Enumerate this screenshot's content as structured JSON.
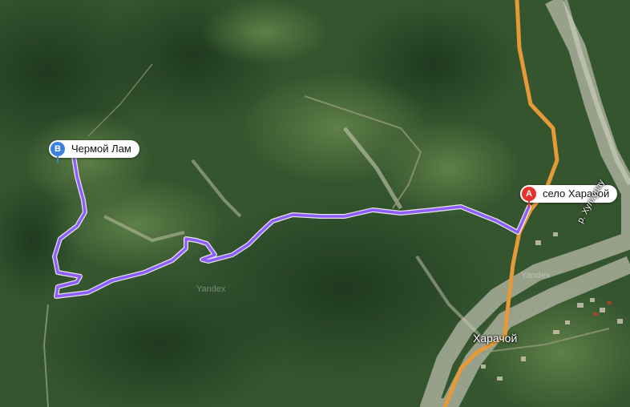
{
  "map": {
    "route_color": "#8f5cff",
    "road_color": "#e59a3a",
    "river_color": "#b8b9a8"
  },
  "markers": {
    "a": {
      "letter": "A",
      "label": "село Харачой",
      "color": "#e8322d"
    },
    "b": {
      "letter": "B",
      "label": "Чермой Лам",
      "color": "#3b82e0"
    }
  },
  "places": {
    "village": "Харачой",
    "river": "р. Хулхулау"
  },
  "watermarks": [
    "Yandex",
    "Yandex"
  ]
}
